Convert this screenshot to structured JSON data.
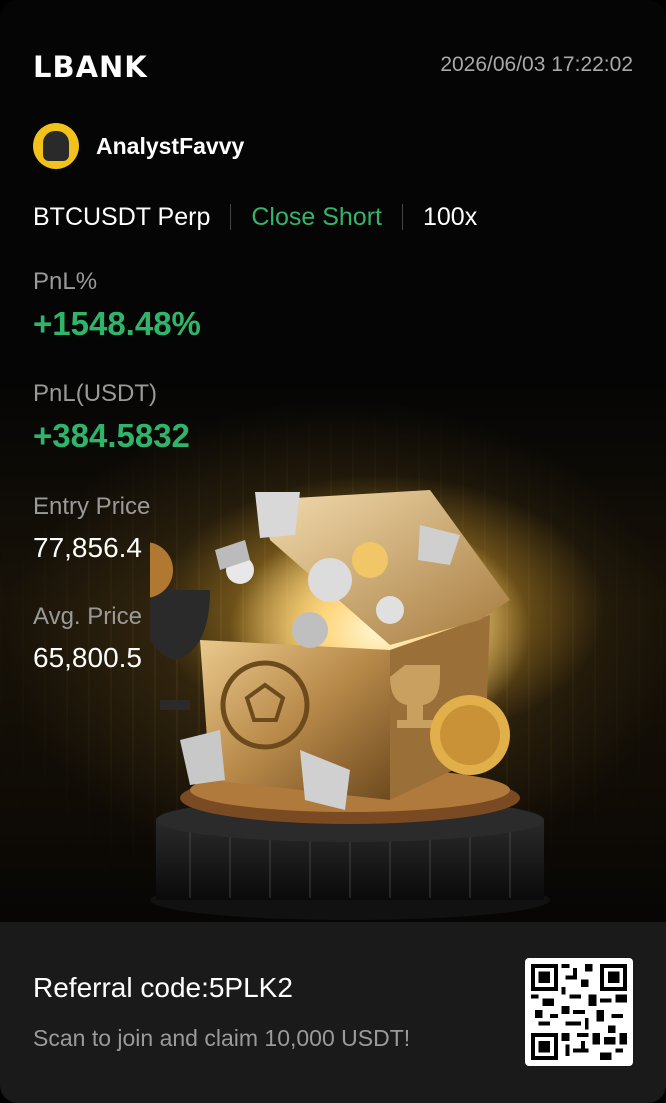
{
  "brand": {
    "logo_text": "LBANK"
  },
  "header": {
    "timestamp": "2026/06/03 17:22:02"
  },
  "user": {
    "name": "AnalystFavvy",
    "avatar_color": "#f1c21b"
  },
  "trade": {
    "pair": "BTCUSDT Perp",
    "side": "Close Short",
    "leverage": "100x",
    "side_color": "#35b36b"
  },
  "stats": {
    "pnl_percent_label": "PnL%",
    "pnl_percent_value": "+1548.48%",
    "pnl_usdt_label": "PnL(USDT)",
    "pnl_usdt_value": "+384.5832",
    "entry_price_label": "Entry Price",
    "entry_price_value": "77,856.4",
    "avg_price_label": "Avg. Price",
    "avg_price_value": "65,800.5",
    "positive_color": "#2fb56a"
  },
  "footer": {
    "referral": "Referral code:5PLK2",
    "scan_text": "Scan to join and claim 10,000 USDT!"
  }
}
